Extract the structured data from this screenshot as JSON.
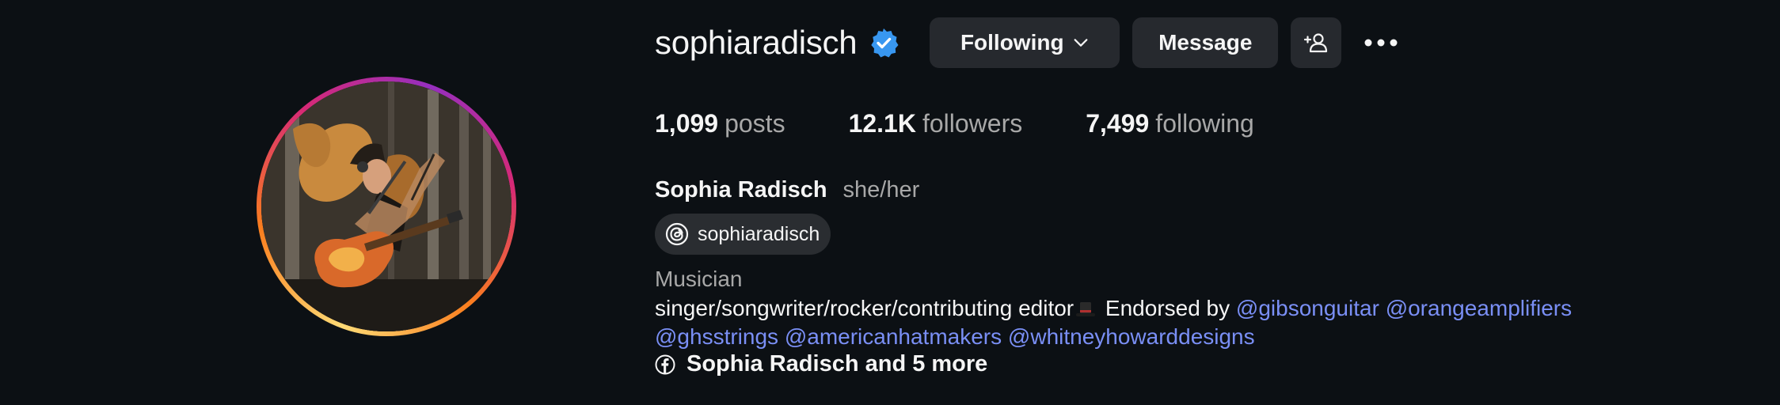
{
  "profile": {
    "username": "sophiaradisch",
    "full_name": "Sophia Radisch",
    "pronouns": "she/her",
    "threads_handle": "sophiaradisch",
    "category": "Musician",
    "verified_icon": "verified-badge-icon",
    "verified_color": "#3897f0"
  },
  "actions": {
    "following_label": "Following",
    "message_label": "Message"
  },
  "stats": {
    "posts_count": "1,099",
    "posts_label": "posts",
    "followers_count": "12.1K",
    "followers_label": "followers",
    "following_count": "7,499",
    "following_label": "following"
  },
  "bio": {
    "text": "singer/songwriter/rocker/contributing editor",
    "emoji_icon": "top-hat-icon",
    "endorsed": " Endorsed by ",
    "mentions": [
      "@gibsonguitar",
      "@orangeamplifiers",
      "@ghsstrings",
      "@americanhatmakers",
      "@whitneyhowarddesigns"
    ],
    "linked_accounts": "Sophia Radisch and 5 more"
  },
  "colors": {
    "background": "#0c1014",
    "button": "#26292e",
    "link": "#7a8ff5",
    "muted": "#a8a8a8"
  }
}
